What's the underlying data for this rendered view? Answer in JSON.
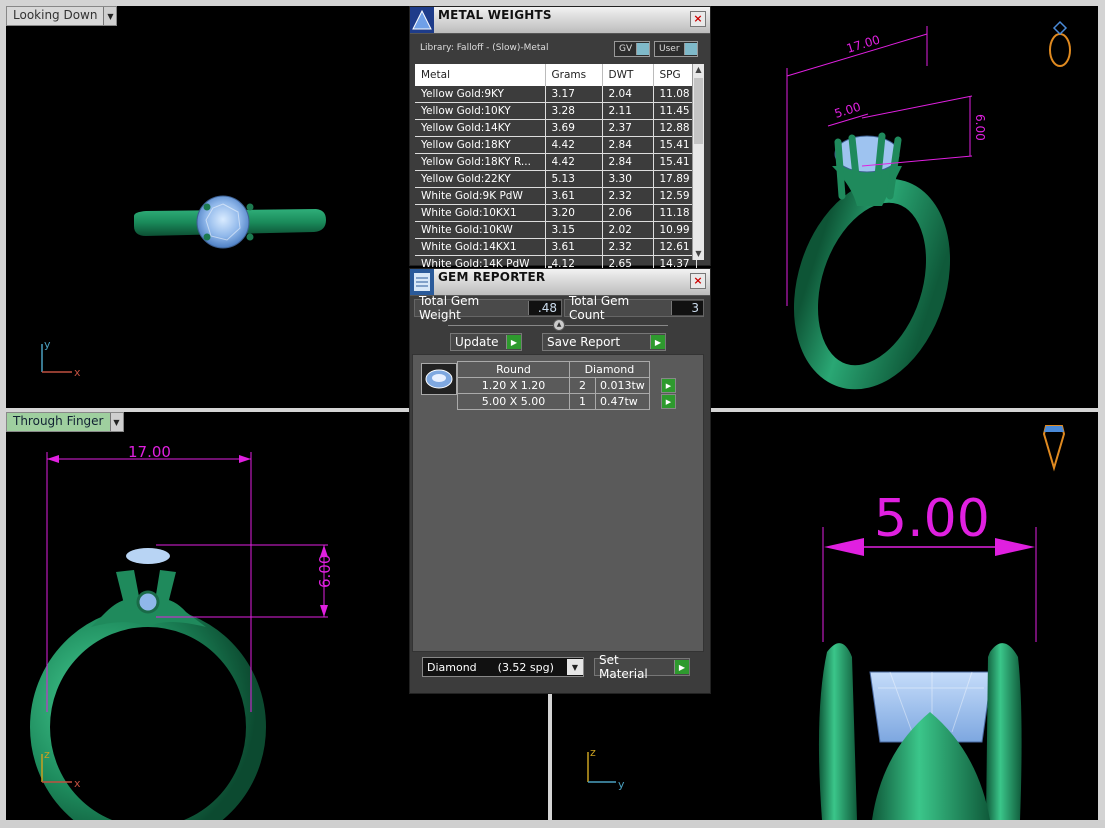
{
  "viewports": {
    "top_left": {
      "label": "Looking Down",
      "axis_y": "y",
      "axis_x": "x"
    },
    "top_right": {
      "dim_length": "17.00",
      "dim_gem": "5.00",
      "dim_height": "6.00"
    },
    "bottom_left": {
      "label": "Through Finger",
      "dim_length": "17.00",
      "dim_height": "6.00",
      "axis_z": "z",
      "axis_x": "x"
    },
    "bottom_right": {
      "dim_gem": "5.00",
      "axis_z": "z",
      "axis_y": "y"
    }
  },
  "metal_weights": {
    "title": "METAL WEIGHTS",
    "library": "Library: Falloff - (Slow)-Metal",
    "toggle_gv": "GV",
    "toggle_user": "User",
    "columns": [
      "Metal",
      "Grams",
      "DWT",
      "SPG"
    ],
    "rows": [
      [
        "Yellow Gold:9KY",
        "3.17",
        "2.04",
        "11.08"
      ],
      [
        "Yellow Gold:10KY",
        "3.28",
        "2.11",
        "11.45"
      ],
      [
        "Yellow Gold:14KY",
        "3.69",
        "2.37",
        "12.88"
      ],
      [
        "Yellow Gold:18KY",
        "4.42",
        "2.84",
        "15.41"
      ],
      [
        "Yellow Gold:18KY R...",
        "4.42",
        "2.84",
        "15.41"
      ],
      [
        "Yellow Gold:22KY",
        "5.13",
        "3.30",
        "17.89"
      ],
      [
        "White Gold:9K PdW",
        "3.61",
        "2.32",
        "12.59"
      ],
      [
        "White Gold:10KX1",
        "3.20",
        "2.06",
        "11.18"
      ],
      [
        "White Gold:10KW",
        "3.15",
        "2.02",
        "10.99"
      ],
      [
        "White Gold:14KX1",
        "3.61",
        "2.32",
        "12.61"
      ],
      [
        "White Gold:14K PdW",
        "4.12",
        "2.65",
        "14.37"
      ]
    ]
  },
  "gem_reporter": {
    "title": "GEM REPORTER",
    "total_weight_label": "Total Gem Weight",
    "total_weight_value": ".48",
    "total_count_label": "Total Gem Count",
    "total_count_value": "3",
    "update_label": "Update",
    "save_report_label": "Save Report",
    "table_headers": [
      "Round",
      "Diamond"
    ],
    "gems": [
      {
        "size": "1.20 X 1.20",
        "count": "2",
        "weight": "0.013tw"
      },
      {
        "size": "5.00 X 5.00",
        "count": "1",
        "weight": "0.47tw"
      }
    ],
    "material_select": "Diamond      (3.52 spg)",
    "set_material_label": "Set Material"
  },
  "colors": {
    "ring_green": "#1f8a5c",
    "dimension_magenta": "#e020e0",
    "gem_blue": "#9ec3f0"
  }
}
